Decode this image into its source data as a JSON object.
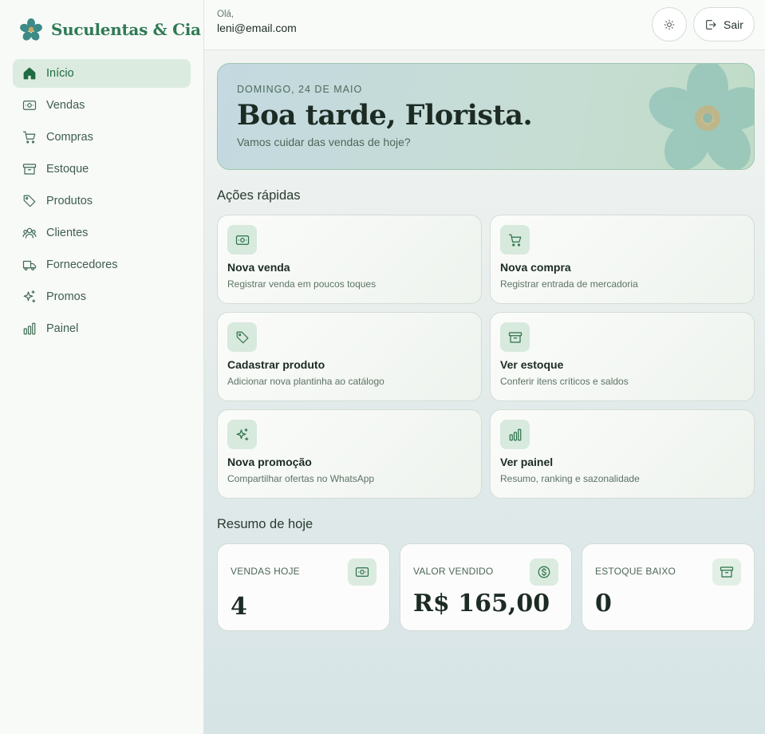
{
  "brand": {
    "name": "Suculentas & Cia",
    "logo_icon": "flower-icon"
  },
  "sidebar": {
    "items": [
      {
        "label": "Início",
        "icon": "home-icon",
        "active": true
      },
      {
        "label": "Vendas",
        "icon": "banknote-icon"
      },
      {
        "label": "Compras",
        "icon": "cart-icon"
      },
      {
        "label": "Estoque",
        "icon": "archive-icon"
      },
      {
        "label": "Produtos",
        "icon": "tag-icon"
      },
      {
        "label": "Clientes",
        "icon": "users-icon"
      },
      {
        "label": "Fornecedores",
        "icon": "truck-icon"
      },
      {
        "label": "Promos",
        "icon": "sparkles-icon"
      },
      {
        "label": "Painel",
        "icon": "bar-chart-icon"
      }
    ]
  },
  "header": {
    "hello": "Olá,",
    "email": "leni@email.com",
    "theme_icon": "sun-icon",
    "exit_label": "Sair",
    "exit_icon": "logout-icon"
  },
  "hero": {
    "date": "DOMINGO, 24 DE MAIO",
    "title": "Boa tarde, Florista.",
    "subtitle": "Vamos cuidar das vendas de hoje?"
  },
  "quick_actions": {
    "title": "Ações rápidas",
    "items": [
      {
        "title": "Nova venda",
        "desc": "Registrar venda em poucos toques",
        "icon": "banknote-icon"
      },
      {
        "title": "Nova compra",
        "desc": "Registrar entrada de mercadoria",
        "icon": "cart-icon"
      },
      {
        "title": "Cadastrar produto",
        "desc": "Adicionar nova plantinha ao catálogo",
        "icon": "tag-icon"
      },
      {
        "title": "Ver estoque",
        "desc": "Conferir itens críticos e saldos",
        "icon": "archive-icon"
      },
      {
        "title": "Nova promoção",
        "desc": "Compartilhar ofertas no WhatsApp",
        "icon": "sparkles-icon"
      },
      {
        "title": "Ver painel",
        "desc": "Resumo, ranking e sazonalidade",
        "icon": "bar-chart-icon"
      }
    ]
  },
  "summary": {
    "title": "Resumo de hoje",
    "stats": [
      {
        "label": "VENDAS HOJE",
        "value": "4",
        "icon": "banknote-icon"
      },
      {
        "label": "VALOR VENDIDO",
        "value": "R$ 165,00",
        "icon": "dollar-circle-icon"
      },
      {
        "label": "ESTOQUE BAIXO",
        "value": "0",
        "icon": "archive-icon"
      }
    ]
  },
  "colors": {
    "accent": "#2f7a54",
    "active_bg": "#dcebe0",
    "icon_bg": "#d8e9dd"
  }
}
